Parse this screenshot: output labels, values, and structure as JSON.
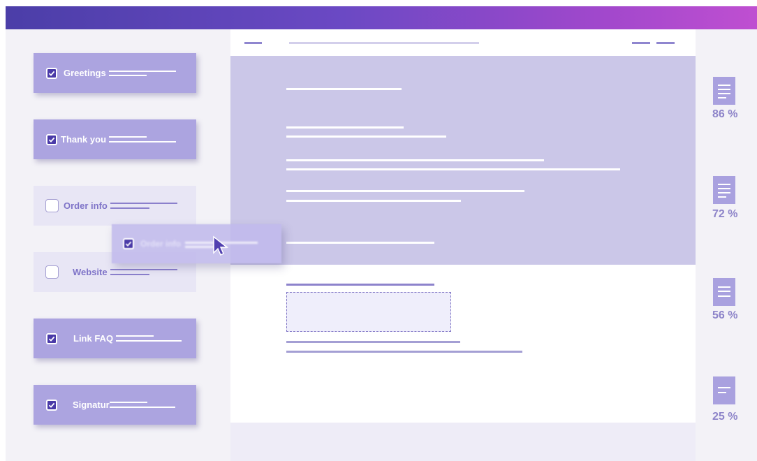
{
  "colors": {
    "header_gradient_start": "#4b3ea8",
    "header_gradient_end": "#bf4fd1",
    "checked_block": "#aca4e0",
    "unchecked_block": "#e8e6f5",
    "email_body": "#cbc7e8",
    "score_text": "#8d84c9"
  },
  "blocks": [
    {
      "label": "Greetings",
      "checked": true
    },
    {
      "label": "Thank you",
      "checked": true
    },
    {
      "label": "Order info",
      "checked": false
    },
    {
      "label": "Website",
      "checked": false
    },
    {
      "label": "Link FAQ",
      "checked": true
    },
    {
      "label": "Signatur",
      "checked": true
    }
  ],
  "dragged_block": {
    "label": "Order info",
    "checked": true
  },
  "scores": [
    {
      "value": "86 %",
      "icon": "document-icon"
    },
    {
      "value": "72 %",
      "icon": "document-icon"
    },
    {
      "value": "56 %",
      "icon": "document-icon"
    },
    {
      "value": "25 %",
      "icon": "document-icon"
    }
  ]
}
